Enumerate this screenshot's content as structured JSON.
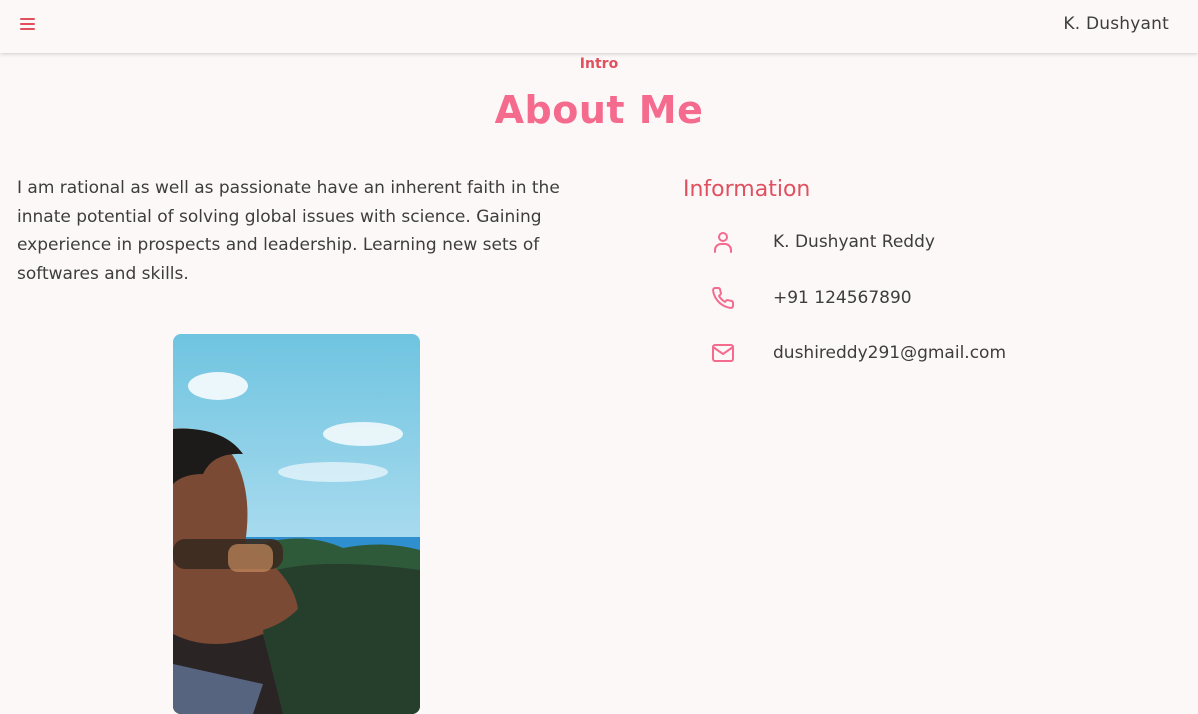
{
  "header": {
    "menu_icon": "hamburger-menu-icon",
    "brand": "K. Dushyant"
  },
  "section": {
    "kicker": "Intro",
    "title": "About Me"
  },
  "about": {
    "bio": "I am rational as well as passionate have an inherent faith in the innate potential of solving global issues with science. Gaining experience in prospects and leadership. Learning new sets of softwares and skills."
  },
  "info": {
    "heading": "Information",
    "items": [
      {
        "icon": "user-icon",
        "value": "K. Dushyant Reddy"
      },
      {
        "icon": "phone-icon",
        "value": "+91 124567890"
      },
      {
        "icon": "mail-icon",
        "value": "dushireddy291@gmail.com"
      }
    ]
  },
  "colors": {
    "accent": "#e0505f",
    "title_pink": "#f46b8e",
    "background": "#fdf8f8",
    "text": "#3d3d3d"
  }
}
